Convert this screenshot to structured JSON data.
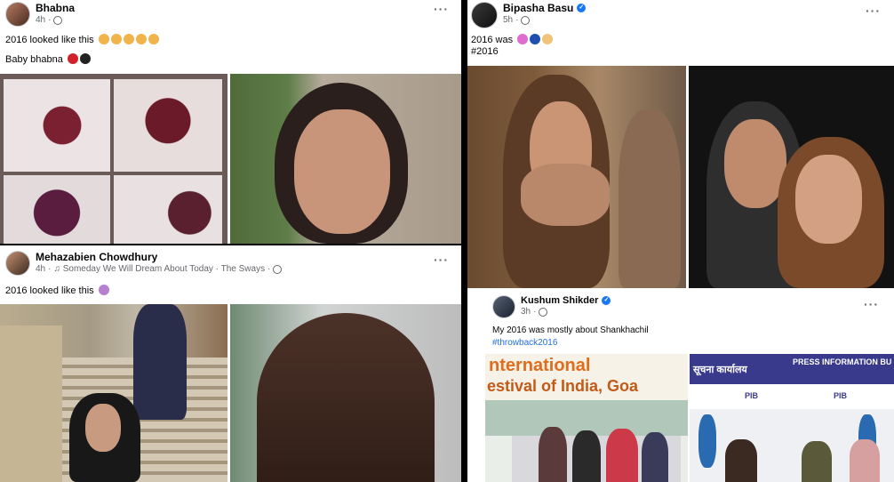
{
  "posts": {
    "bhabna": {
      "author": "Bhabna",
      "time": "4h",
      "text1": "2016 looked like this",
      "text2": "Baby bhabna",
      "more": "···"
    },
    "mehazabien": {
      "author": "Mehazabien Chowdhury",
      "time": "4h",
      "music": "♫ Someday We Will Dream About Today · The Sways",
      "text": "2016 looked like this",
      "more": "···"
    },
    "bipasha": {
      "author": "Bipasha Basu",
      "time": "5h",
      "text": "2016 was",
      "hashtag": "#2016",
      "more": "···"
    },
    "kushum": {
      "author": "Kushum Shikder",
      "time": "3h",
      "text": "My 2016 was mostly about Shankhachil",
      "hashtag": "#throwback2016",
      "more": "···"
    }
  },
  "signs": {
    "festival_line1": "nternational",
    "festival_line2": "estival of India, Goa",
    "hindi": "सूचना कार्यालय",
    "pib_banner": "PRESS INFORMATION BU",
    "pib_logo": "PIB"
  },
  "icons": {
    "verified": "verified-badge-icon",
    "globe": "globe-icon",
    "more": "more-options-icon",
    "music": "music-note-icon"
  },
  "colors": {
    "link": "#216fdb",
    "verified": "#1877f2",
    "meta_text": "#65676b"
  }
}
